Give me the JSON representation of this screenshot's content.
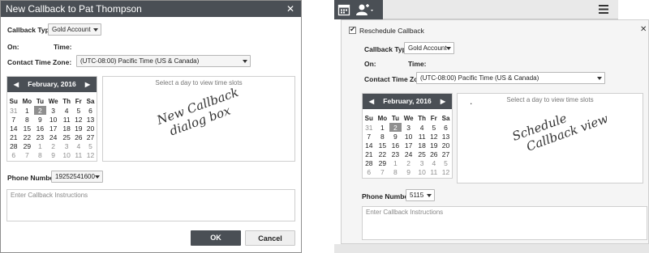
{
  "left": {
    "title": "New Callback to Pat Thompson",
    "close": "✕",
    "callback_type_label": "Callback Type:",
    "callback_type_value": "Gold Account",
    "on_label": "On:",
    "time_label": "Time:",
    "timezone_label": "Contact Time Zone:",
    "timezone_value": "(UTC-08:00) Pacific Time (US & Canada)",
    "slots_hint": "Select a day to view time slots",
    "annotation_line1": "New Callback",
    "annotation_line2": "dialog box",
    "phone_label": "Phone Number:",
    "phone_value": "19252541600",
    "instructions_placeholder": "Enter Callback Instructions",
    "ok_label": "OK",
    "cancel_label": "Cancel"
  },
  "right": {
    "reschedule_label": "Reschedule Callback",
    "close": "✕",
    "callback_type_label": "Callback Type:",
    "callback_type_value": "Gold Account",
    "on_label": "On:",
    "time_label": "Time:",
    "timezone_label": "Contact Time Zone:",
    "timezone_value": "(UTC-08:00) Pacific Time (US & Canada)",
    "slots_hint": "Select a day to view time slots",
    "annotation_line1": "Schedule",
    "annotation_line2": "Callback view",
    "phone_label": "Phone Number:",
    "phone_value": "5115",
    "instructions_placeholder": "Enter Callback Instructions",
    "slot_dot": "."
  },
  "calendar": {
    "month_label": "February, 2016",
    "prev": "◀",
    "next": "▶",
    "weekdays": [
      "Su",
      "Mo",
      "Tu",
      "We",
      "Th",
      "Fr",
      "Sa"
    ],
    "weeks": [
      [
        "31",
        "1",
        "2",
        "3",
        "4",
        "5",
        "6"
      ],
      [
        "7",
        "8",
        "9",
        "10",
        "11",
        "12",
        "13"
      ],
      [
        "14",
        "15",
        "16",
        "17",
        "18",
        "19",
        "20"
      ],
      [
        "21",
        "22",
        "23",
        "24",
        "25",
        "26",
        "27"
      ],
      [
        "28",
        "29",
        "1",
        "2",
        "3",
        "4",
        "5"
      ],
      [
        "6",
        "7",
        "8",
        "9",
        "10",
        "11",
        "12"
      ]
    ],
    "selected_day": "2"
  },
  "colors": {
    "header_dark": "#4a4f55",
    "selected_day": "#8f8f8f",
    "other_month_text": "#8f8f8f"
  },
  "icons": [
    "calendar-icon",
    "contact-icon",
    "chevron-down-icon",
    "hamburger-menu-icon",
    "close-icon",
    "checkbox-icon"
  ]
}
